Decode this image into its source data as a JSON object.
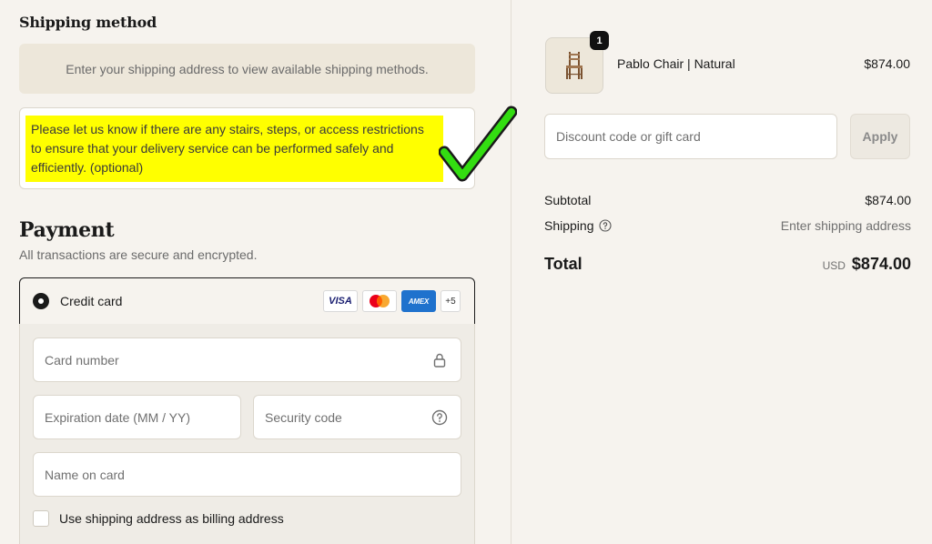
{
  "shipping": {
    "title": "Shipping method",
    "info": "Enter your shipping address to view available shipping methods.",
    "notes_text": "Please let us know if there are any stairs, steps, or access restrictions to ensure that your delivery service can be performed safely and efficiently. (optional)"
  },
  "payment": {
    "title": "Payment",
    "subtitle": "All transactions are secure and encrypted.",
    "method_label": "Credit card",
    "card_brands": [
      "VISA",
      "Mastercard",
      "AMEX"
    ],
    "more_brands": "+5",
    "card_number_placeholder": "Card number",
    "expiration_placeholder": "Expiration date (MM / YY)",
    "security_placeholder": "Security code",
    "name_placeholder": "Name on card",
    "billing_label": "Use shipping address as billing address",
    "billing_checked": false
  },
  "order": {
    "quantity": "1",
    "product_name": "Pablo Chair | Natural",
    "product_price": "$874.00",
    "discount_placeholder": "Discount code or gift card",
    "apply_label": "Apply",
    "subtotal_label": "Subtotal",
    "subtotal_value": "$874.00",
    "shipping_label": "Shipping",
    "shipping_value": "Enter shipping address",
    "total_label": "Total",
    "currency": "USD",
    "total_value": "$874.00"
  },
  "colors": {
    "background": "#f6f3ee",
    "highlight": "#ffff00",
    "checkmark": "#33dd11",
    "accent_dark": "#1a1a1a"
  },
  "icons": [
    "lock-icon",
    "help-circle-icon",
    "checkmark-annotation-icon",
    "chair-thumbnail"
  ]
}
